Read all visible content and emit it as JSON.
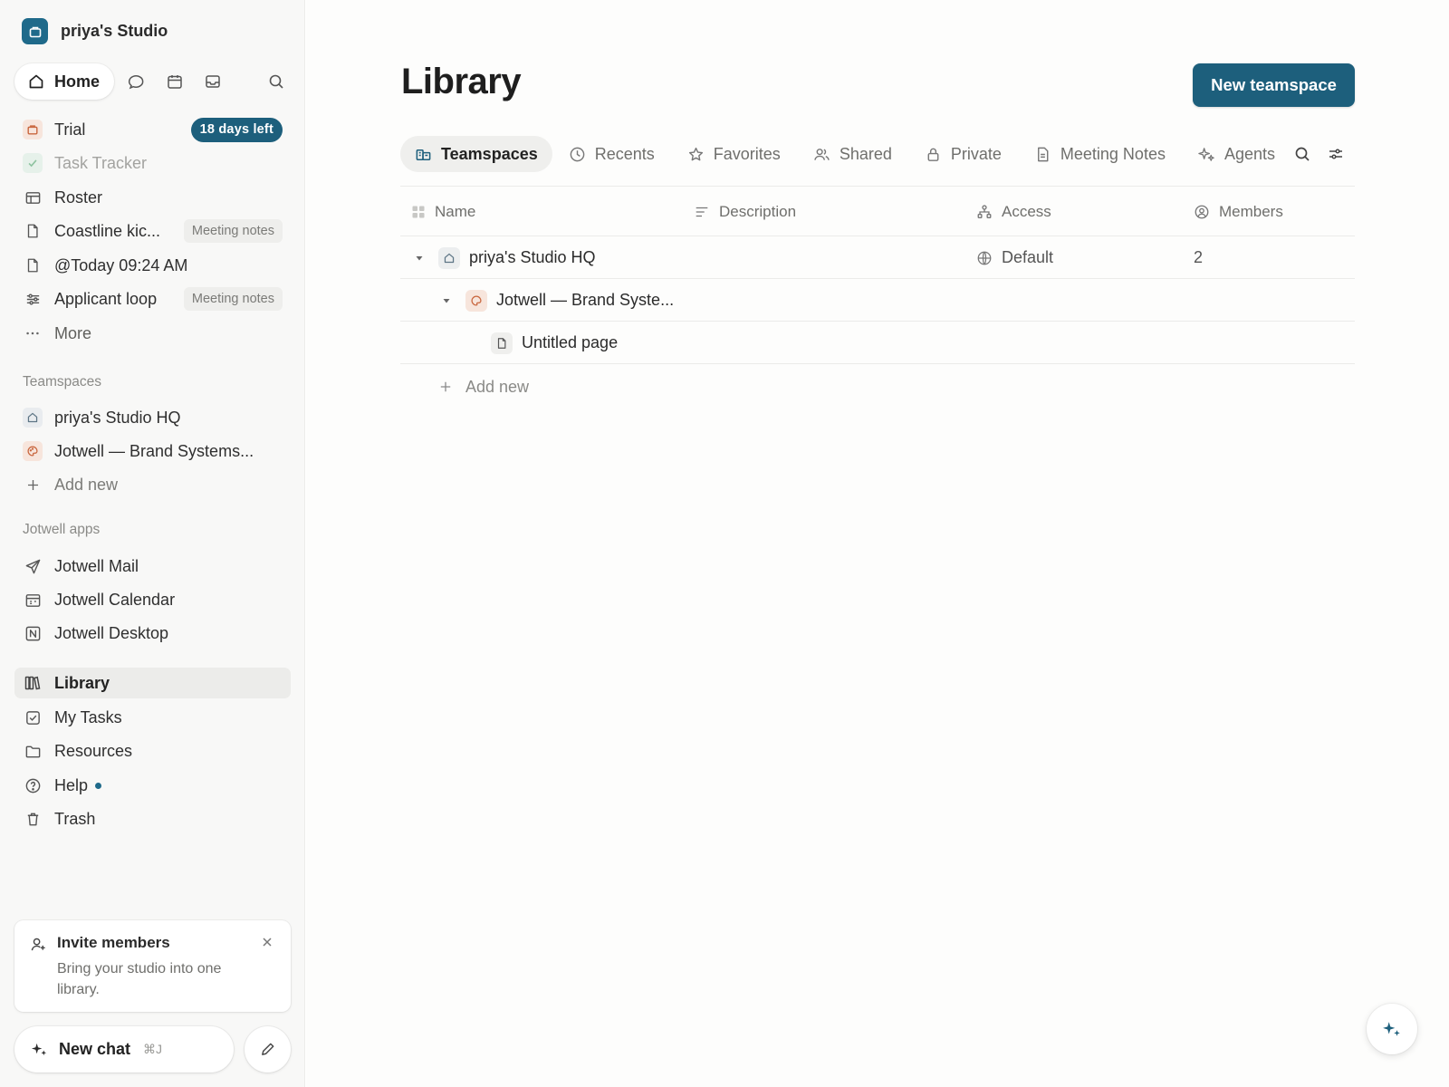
{
  "workspace": {
    "name": "priya's Studio"
  },
  "topnav": {
    "home_label": "Home"
  },
  "sidebar": {
    "items": [
      {
        "label": "Trial",
        "badge": "18 days left"
      },
      {
        "label": "Task Tracker"
      },
      {
        "label": "Roster"
      },
      {
        "label": "Coastline kic...",
        "tag": "Meeting notes"
      },
      {
        "label": "@Today 09:24 AM"
      },
      {
        "label": "Applicant loop",
        "tag": "Meeting notes"
      },
      {
        "label": "More"
      }
    ],
    "teamspaces_title": "Teamspaces",
    "teamspaces": [
      {
        "label": "priya's Studio HQ"
      },
      {
        "label": "Jotwell — Brand Systems..."
      }
    ],
    "teamspaces_add": "Add new",
    "apps_title": "Jotwell apps",
    "apps": [
      {
        "label": "Jotwell Mail"
      },
      {
        "label": "Jotwell Calendar"
      },
      {
        "label": "Jotwell Desktop"
      }
    ],
    "bottom": [
      {
        "label": "Library"
      },
      {
        "label": "My Tasks"
      },
      {
        "label": "Resources"
      },
      {
        "label": "Help"
      },
      {
        "label": "Trash"
      }
    ]
  },
  "invite": {
    "title": "Invite members",
    "body": "Bring your studio into one library."
  },
  "newchat": {
    "label": "New chat",
    "shortcut": "⌘J"
  },
  "main": {
    "title": "Library",
    "primary_button": "New teamspace",
    "tabs": [
      {
        "label": "Teamspaces"
      },
      {
        "label": "Recents"
      },
      {
        "label": "Favorites"
      },
      {
        "label": "Shared"
      },
      {
        "label": "Private"
      },
      {
        "label": "Meeting Notes"
      },
      {
        "label": "Agents"
      }
    ],
    "columns": [
      "Name",
      "Description",
      "Access",
      "Members"
    ],
    "rows": [
      {
        "name": "priya's Studio HQ",
        "access": "Default",
        "members": "2"
      },
      {
        "name": "Jotwell — Brand Syste..."
      },
      {
        "name": "Untitled page"
      }
    ],
    "add_new": "Add new"
  },
  "colors": {
    "accent": "#1d5f7c",
    "sidebar_bg": "#f8f8f7",
    "trial_orange": "#c9673f"
  }
}
